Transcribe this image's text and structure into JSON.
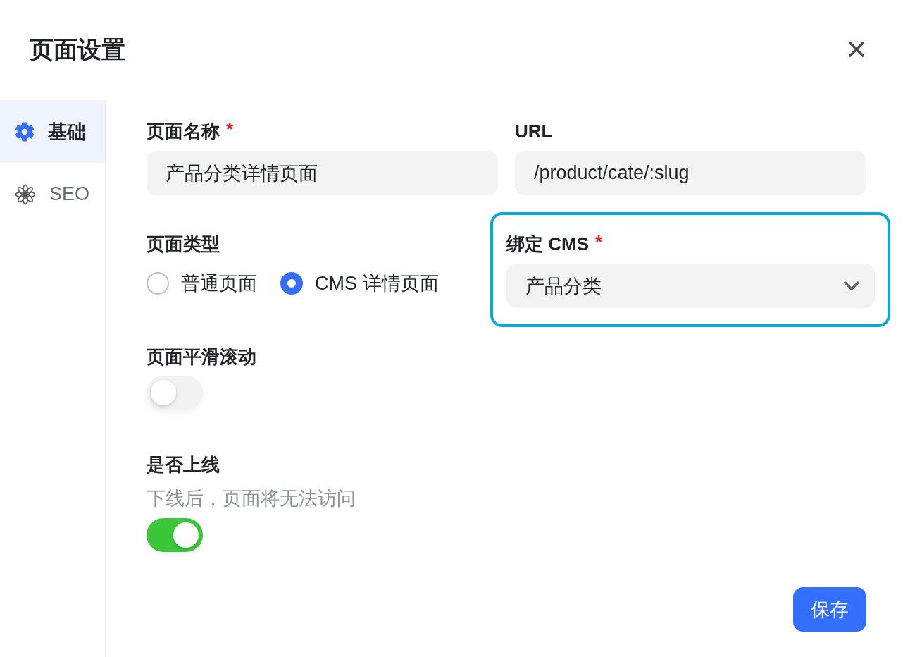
{
  "dialog": {
    "title": "页面设置"
  },
  "sidebar": {
    "items": [
      {
        "label": "基础",
        "selected": true
      },
      {
        "label": "SEO",
        "selected": false
      }
    ]
  },
  "form": {
    "fields": [
      {
        "kind": "text",
        "label": "页面名称",
        "required_mark": "*",
        "value": "产品分类详情页面"
      },
      {
        "kind": "text",
        "label": "URL",
        "value": "/product/cate/:slug"
      },
      {
        "kind": "radio",
        "label": "页面类型",
        "options": [
          {
            "label": "普通页面",
            "selected": false
          },
          {
            "label": "CMS 详情页面",
            "selected": true
          }
        ]
      },
      {
        "kind": "select",
        "label": "绑定 CMS",
        "required_mark": "*",
        "value": "产品分类",
        "highlighted": true
      },
      {
        "kind": "switch",
        "label": "页面平滑滚动",
        "on": false
      },
      {
        "kind": "switch",
        "label": "是否上线",
        "description": "下线后，页面将无法访问",
        "on": true
      }
    ]
  },
  "save_button": {
    "label": "保存"
  }
}
